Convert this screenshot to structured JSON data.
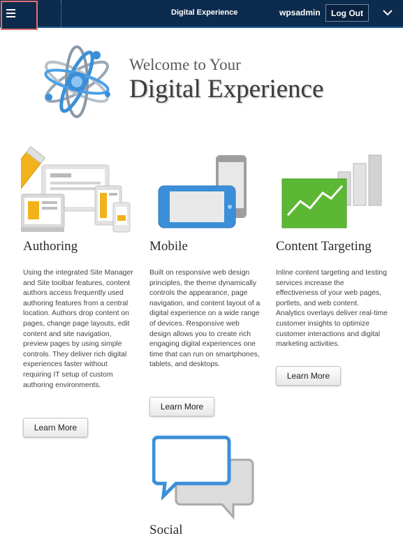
{
  "header": {
    "title": "Digital Experience",
    "user": "wpsadmin",
    "logout_label": "Log Out"
  },
  "hero": {
    "line1": "Welcome to Your",
    "line2": "Digital Experience"
  },
  "features": [
    {
      "heading": "Authoring",
      "text": "Using the integrated Site Manager and Site toolbar features, content authors access frequently used authoring features from a central location. Authors drop content on pages, change page layouts, edit content and site navigation, preview pages by using simple controls. They deliver rich digital experiences faster without requiring IT setup of custom authoring environments.",
      "button": "Learn More"
    },
    {
      "heading": "Mobile",
      "text": "Built on responsive web design principles, the theme dynamically controls the appearance, page navigation, and content layout of a digital experience on a wide range of devices. Responsive web design allows you to create rich engaging digital experiences one time that can run on smartphones, tablets, and desktops.",
      "button": "Learn More"
    },
    {
      "heading": "Content Targeting",
      "text": "Inline content targeting and testing services increase the effectiveness of your web pages, portlets, and web content. Analytics overlays deliver real-time customer insights to optimize customer interactions and digital marketing activities.",
      "button": "Learn More"
    },
    {
      "heading": "Social"
    }
  ],
  "colors": {
    "topbar": "#0d2b4c",
    "accent_blue": "#3b8fd8",
    "green": "#5cb834",
    "yellow": "#f2b21c"
  }
}
